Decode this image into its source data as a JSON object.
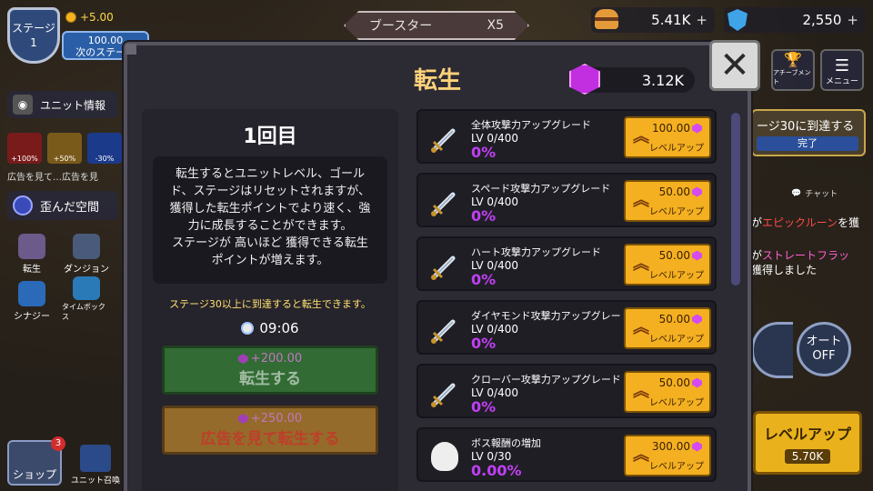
{
  "hud": {
    "stage_label": "ステージ",
    "stage_number": "1",
    "gold_per": "+5.00",
    "next_stage_value": "100.00",
    "next_stage_label": "次のステージ",
    "booster_label": "ブースター",
    "booster_mult": "X5",
    "gold_amount": "5.41K",
    "gem_amount": "2,550",
    "plus": "+"
  },
  "left_menu": {
    "unit_info": "ユニット情報",
    "buffs": [
      "+100%",
      "+50%",
      "-30%"
    ],
    "ad_text": "広告を見て…広告を見",
    "warp": "歪んだ空間",
    "tiles": [
      "転生",
      "ダンジョン",
      "シナジー",
      "タイムボックス"
    ],
    "shop": "ショップ",
    "shop_badge": "3",
    "summon": "ユニット召喚"
  },
  "right_menu": {
    "achievement": "アチーブメント",
    "menu": "メニュー",
    "quest_text": "ージ30に到達する",
    "quest_done": "完了",
    "chat_label": "チャット",
    "chat1_pre": "が",
    "chat1_hl": "エピックルーン",
    "chat1_post": "を獲",
    "chat2_pre": "が",
    "chat2_hl": "ストレートフラッ",
    "chat3": "獲得しました",
    "auto_label": "オート",
    "auto_state": "OFF",
    "levelup_label": "レベルアップ",
    "levelup_cost": "5.70K"
  },
  "modal": {
    "title": "転生",
    "gems": "3.12K",
    "close": "✕",
    "round": "1回目",
    "description_lines": [
      "転生するとユニットレベル、ゴール",
      "ド、ステージはリセットされますが、",
      "獲得した転生ポイントでより速く、強",
      "力に成長することができます。",
      "ステージが 高いほど 獲得できる転生",
      "ポイントが増えます。"
    ],
    "condition": "ステージ30以上に到達すると転生できます。",
    "timer": "09:06",
    "rebirth_cost": "+200.00",
    "rebirth_label": "転生する",
    "ad_cost": "+250.00",
    "ad_label": "広告を見て転生する"
  },
  "upgrades": [
    {
      "name": "全体攻撃力アップグレード",
      "level": "LV 0/400",
      "percent": "0%",
      "cost": "100.00",
      "button": "レベルアップ",
      "icon": "sword-icon"
    },
    {
      "name": "スペード攻撃力アップグレード",
      "level": "LV 0/400",
      "percent": "0%",
      "cost": "50.00",
      "button": "レベルアップ",
      "icon": "sword-icon"
    },
    {
      "name": "ハート攻撃力アップグレード",
      "level": "LV 0/400",
      "percent": "0%",
      "cost": "50.00",
      "button": "レベルアップ",
      "icon": "sword-icon"
    },
    {
      "name": "ダイヤモンド攻撃力アップグレード",
      "level": "LV 0/400",
      "percent": "0%",
      "cost": "50.00",
      "button": "レベルアップ",
      "icon": "sword-icon"
    },
    {
      "name": "クローバー攻撃力アップグレード",
      "level": "LV 0/400",
      "percent": "0%",
      "cost": "50.00",
      "button": "レベルアップ",
      "icon": "sword-icon"
    },
    {
      "name": "ボス報酬の増加",
      "level": "LV 0/30",
      "percent": "0.00%",
      "cost": "300.00",
      "button": "レベルアップ",
      "icon": "skull-icon"
    }
  ],
  "colors": {
    "accent_purple": "#c13ff5",
    "button_gold": "#f4b021",
    "title_gold": "#ffd27a"
  }
}
